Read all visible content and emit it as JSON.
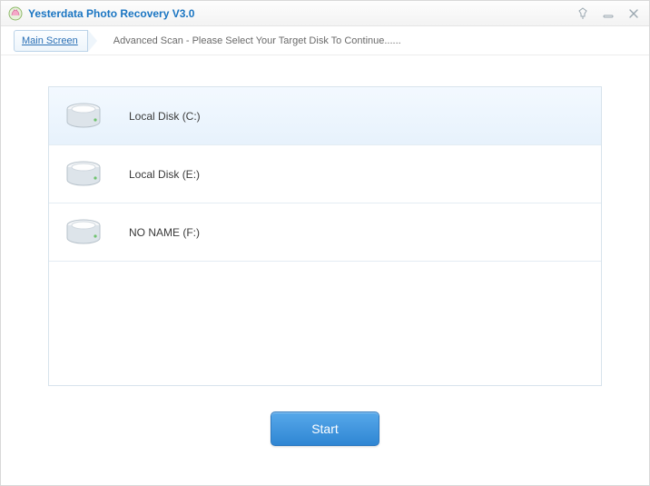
{
  "window": {
    "title": "Yesterdata Photo Recovery V3.0"
  },
  "breadcrumb": {
    "main_label": "Main Screen",
    "description": "Advanced Scan - Please Select Your Target Disk To Continue......"
  },
  "disks": [
    {
      "label": "Local Disk (C:)",
      "selected": true
    },
    {
      "label": "Local Disk (E:)",
      "selected": false
    },
    {
      "label": "NO NAME (F:)",
      "selected": false
    }
  ],
  "buttons": {
    "start": "Start"
  }
}
